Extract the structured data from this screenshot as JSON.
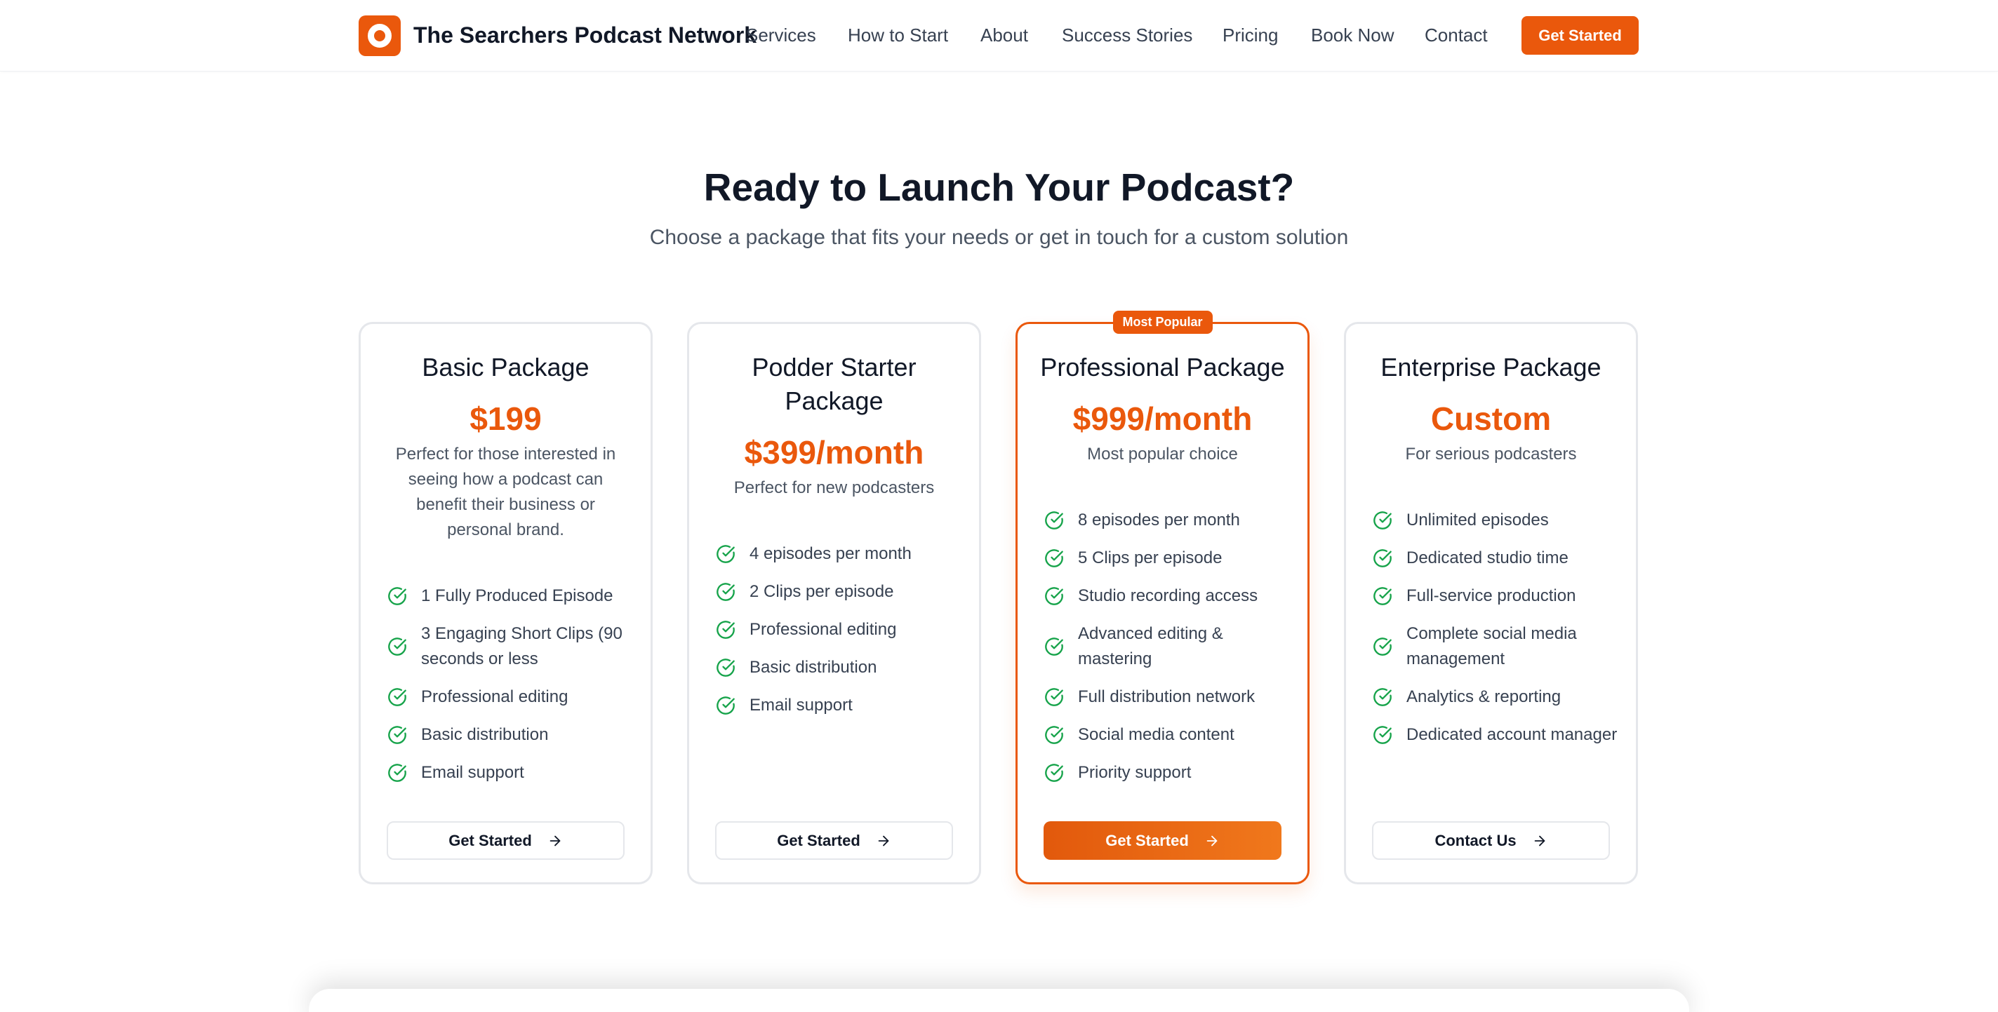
{
  "header": {
    "brand": "The Searchers Podcast Network",
    "nav": [
      "Services",
      "How to Start",
      "About",
      "Success Stories",
      "Pricing",
      "Book Now",
      "Contact"
    ],
    "cta_label": "Get Started"
  },
  "hero": {
    "title": "Ready to Launch Your Podcast?",
    "subtitle": "Choose a package that fits your needs or get in touch for a custom solution"
  },
  "colors": {
    "accent": "#ea580c",
    "check": "#16a34a"
  },
  "packages": [
    {
      "title": "Basic Package",
      "price": "$199",
      "description": "Perfect for those interested in seeing how a podcast can benefit their business or personal brand.",
      "features": [
        "1 Fully Produced Episode",
        "3 Engaging Short Clips (90 seconds or less",
        "Professional editing",
        "Basic distribution",
        "Email support"
      ],
      "button": "Get Started"
    },
    {
      "title": "Podder Starter Package",
      "price": "$399/month",
      "description": "Perfect for new podcasters",
      "features": [
        "4 episodes per month",
        "2 Clips per episode",
        "Professional editing",
        "Basic distribution",
        "Email support"
      ],
      "button": "Get Started"
    },
    {
      "badge": "Most Popular",
      "title": "Professional Package",
      "price": "$999/month",
      "description": "Most popular choice",
      "features": [
        "8 episodes per month",
        "5 Clips per episode",
        "Studio recording access",
        "Advanced editing & mastering",
        "Full distribution network",
        "Social media content",
        "Priority support"
      ],
      "button": "Get Started"
    },
    {
      "title": "Enterprise Package",
      "price": "Custom",
      "description": "For serious podcasters",
      "features": [
        "Unlimited episodes",
        "Dedicated studio time",
        "Full-service production",
        "Complete social media management",
        "Analytics & reporting",
        "Dedicated account manager"
      ],
      "button": "Contact Us"
    }
  ]
}
